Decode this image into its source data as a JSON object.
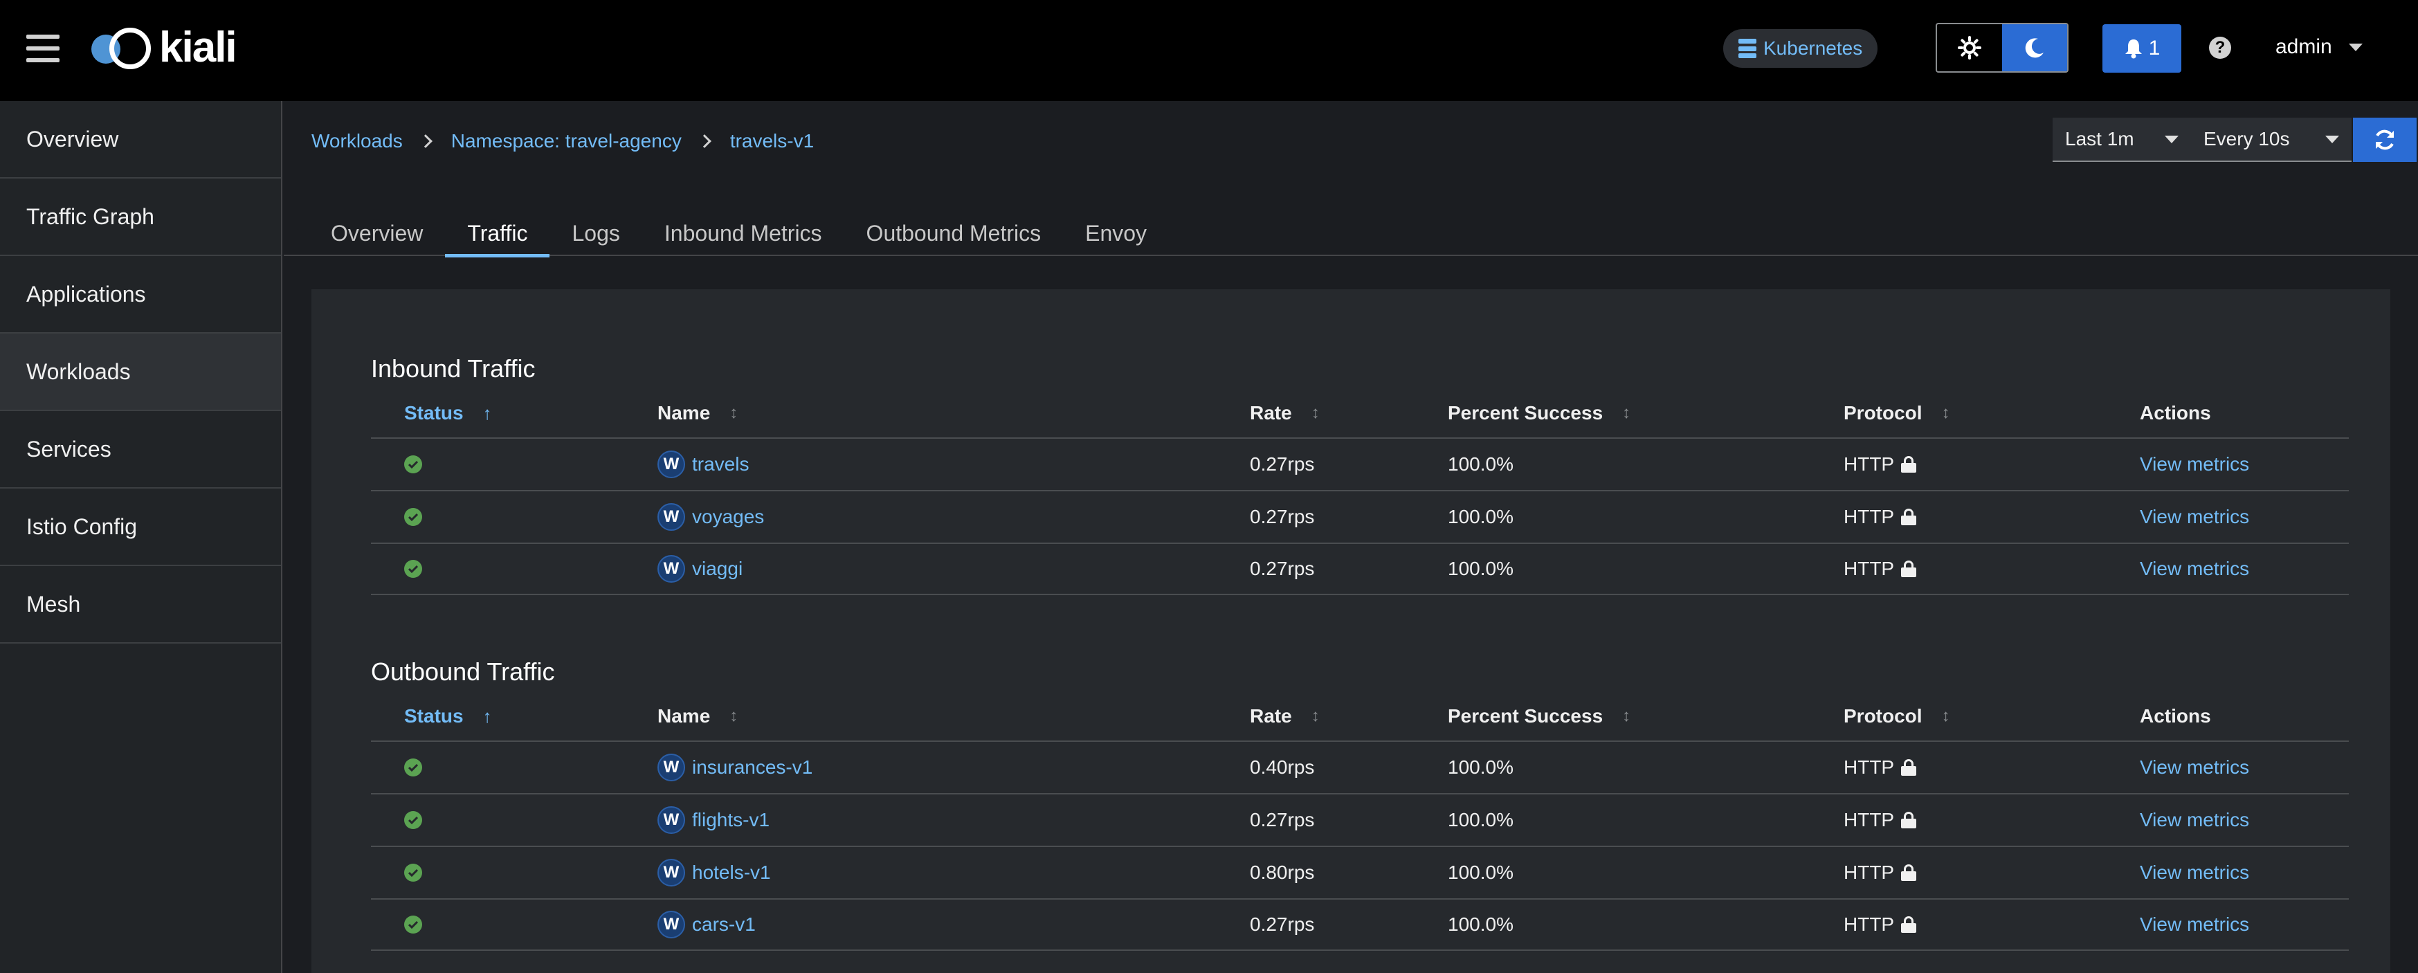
{
  "app": {
    "logo_text": "kiali"
  },
  "masthead": {
    "cluster_badge": "Kubernetes",
    "notifications_count": "1",
    "help": "?",
    "user": "admin"
  },
  "sidebar": {
    "items": [
      {
        "label": "Overview"
      },
      {
        "label": "Traffic Graph"
      },
      {
        "label": "Applications"
      },
      {
        "label": "Workloads",
        "active": true
      },
      {
        "label": "Services"
      },
      {
        "label": "Istio Config"
      },
      {
        "label": "Mesh"
      }
    ]
  },
  "breadcrumb": {
    "items": [
      "Workloads",
      "Namespace: travel-agency",
      "travels-v1"
    ]
  },
  "time_controls": {
    "range": "Last 1m",
    "refresh": "Every 10s"
  },
  "tabs": [
    {
      "label": "Overview"
    },
    {
      "label": "Traffic",
      "active": true
    },
    {
      "label": "Logs"
    },
    {
      "label": "Inbound Metrics"
    },
    {
      "label": "Outbound Metrics"
    },
    {
      "label": "Envoy"
    }
  ],
  "columns": {
    "status": "Status",
    "name": "Name",
    "rate": "Rate",
    "percent_success": "Percent Success",
    "protocol": "Protocol",
    "actions": "Actions"
  },
  "inbound": {
    "title": "Inbound Traffic",
    "rows": [
      {
        "badge": "W",
        "name": "travels",
        "rate": "0.27rps",
        "pct": "100.0%",
        "protocol": "HTTP",
        "action": "View metrics"
      },
      {
        "badge": "W",
        "name": "voyages",
        "rate": "0.27rps",
        "pct": "100.0%",
        "protocol": "HTTP",
        "action": "View metrics"
      },
      {
        "badge": "W",
        "name": "viaggi",
        "rate": "0.27rps",
        "pct": "100.0%",
        "protocol": "HTTP",
        "action": "View metrics"
      }
    ]
  },
  "outbound": {
    "title": "Outbound Traffic",
    "rows": [
      {
        "badge": "W",
        "name": "insurances-v1",
        "rate": "0.40rps",
        "pct": "100.0%",
        "protocol": "HTTP",
        "action": "View metrics"
      },
      {
        "badge": "W",
        "name": "flights-v1",
        "rate": "0.27rps",
        "pct": "100.0%",
        "protocol": "HTTP",
        "action": "View metrics"
      },
      {
        "badge": "W",
        "name": "hotels-v1",
        "rate": "0.80rps",
        "pct": "100.0%",
        "protocol": "HTTP",
        "action": "View metrics"
      },
      {
        "badge": "W",
        "name": "cars-v1",
        "rate": "0.27rps",
        "pct": "100.0%",
        "protocol": "HTTP",
        "action": "View metrics"
      }
    ]
  },
  "colors": {
    "accent": "#2b6cd4",
    "link": "#73bcf7",
    "success": "#5ba352",
    "masthead": "#000000",
    "background": "#1b1d21"
  }
}
